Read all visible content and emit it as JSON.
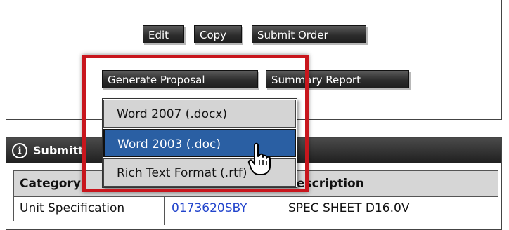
{
  "toolbar": {
    "edit_label": "Edit",
    "copy_label": "Copy",
    "submit_label": "Submit Order",
    "generate_proposal_label": "Generate Proposal",
    "summary_report_label": "Summary Report"
  },
  "menu": {
    "items": [
      {
        "label": "Word 2007 (.docx)"
      },
      {
        "label": "Word 2003 (.doc)",
        "active": true
      },
      {
        "label": "Rich Text Format (.rtf)"
      }
    ]
  },
  "panel": {
    "title": "Submitt"
  },
  "table": {
    "headers": [
      "Category",
      "escription"
    ],
    "rows": [
      {
        "category": "Unit Specification",
        "link": "0173620SBY",
        "description": "SPEC SHEET D16.0V"
      }
    ]
  },
  "colors": {
    "highlight": "#c8161d",
    "menu_active": "#2a5fa3",
    "button_bg": "#2d2d2d",
    "link": "#2244cc"
  },
  "icons": {
    "panel_icon": "info-icon",
    "cursor": "hand-pointer-icon"
  }
}
